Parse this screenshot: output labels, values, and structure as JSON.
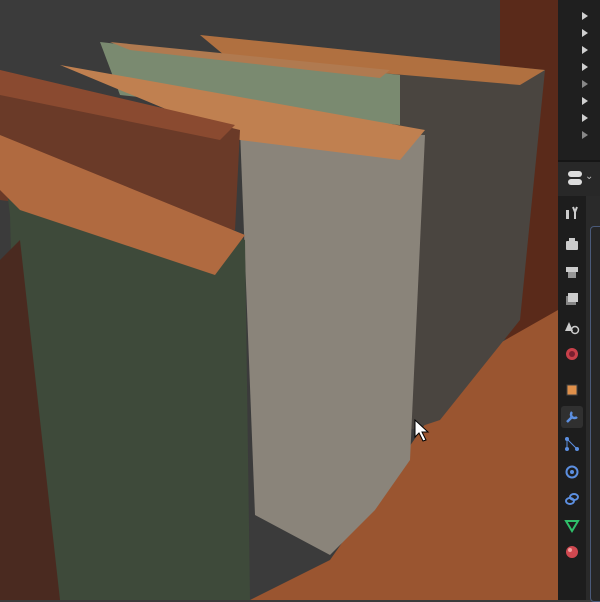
{
  "app": "Blender",
  "outliner": {
    "rows": 8
  },
  "properties": {
    "active_tab": "modifiers",
    "tabs": [
      {
        "name": "tool",
        "color": "#cccccc"
      },
      {
        "name": "render",
        "color": "#cccccc"
      },
      {
        "name": "output",
        "color": "#cccccc"
      },
      {
        "name": "view-layer",
        "color": "#cccccc"
      },
      {
        "name": "scene",
        "color": "#cccccc"
      },
      {
        "name": "world",
        "color": "#c8404a"
      },
      {
        "name": "object",
        "color": "#e0904a"
      },
      {
        "name": "modifiers",
        "color": "#5c8fe0"
      },
      {
        "name": "particles",
        "color": "#5c8fe0"
      },
      {
        "name": "physics",
        "color": "#5c8fe0"
      },
      {
        "name": "constraints",
        "color": "#5c8fe0"
      },
      {
        "name": "data",
        "color": "#2fbf6a"
      },
      {
        "name": "material",
        "color": "#d04850"
      }
    ]
  },
  "colors": {
    "viewport_bg": "#3b3b3b",
    "shelf": "#8a4a2a",
    "accent": "#5c8fe0"
  }
}
